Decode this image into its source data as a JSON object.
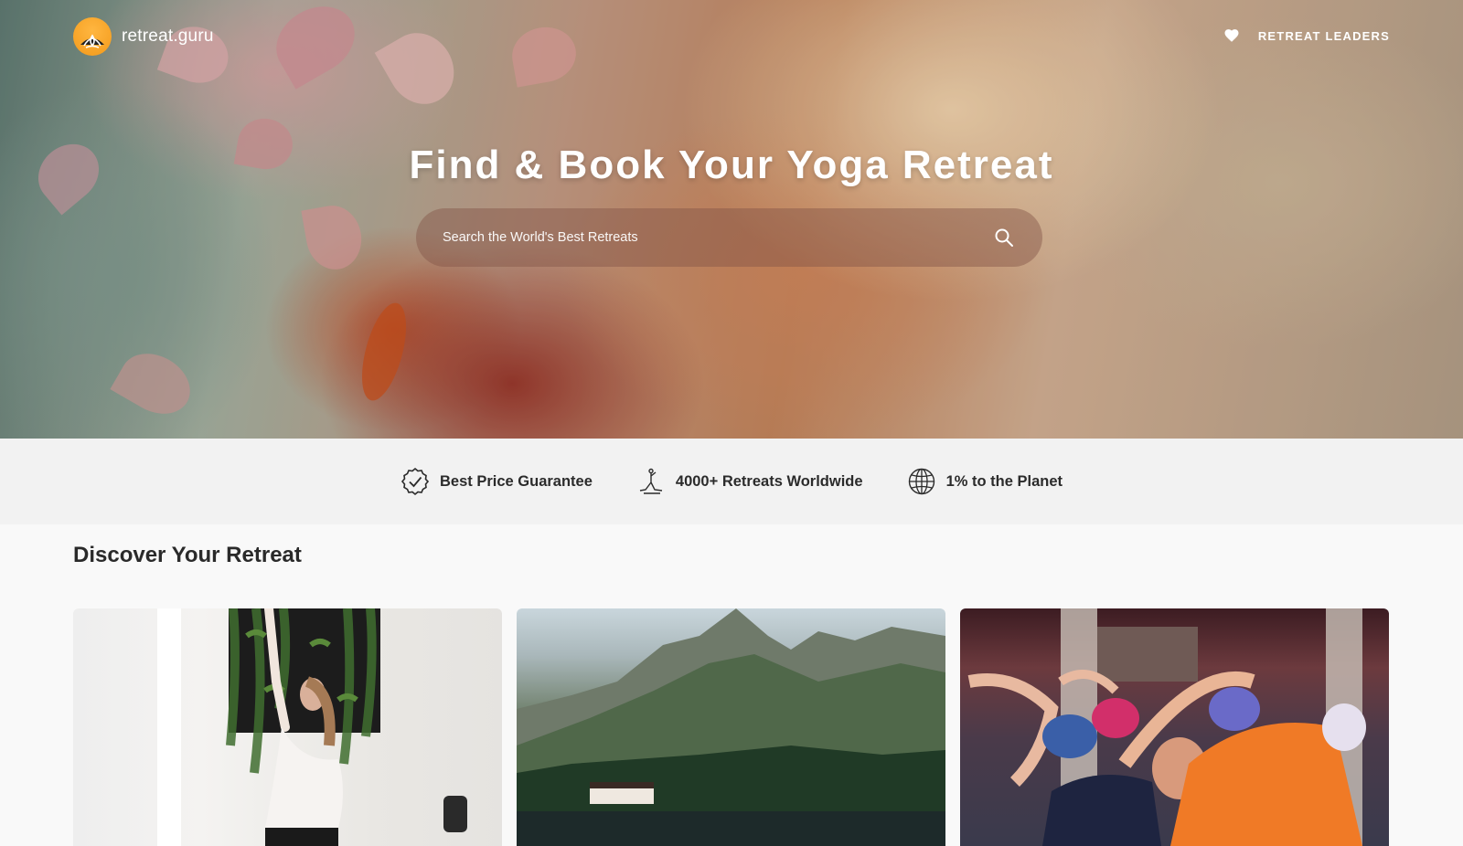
{
  "header": {
    "logo_text": "retreat.guru",
    "nav_link": "RETREAT LEADERS",
    "icons": {
      "logo": "lotus-sun-logo",
      "favorites": "heart-icon"
    }
  },
  "hero": {
    "title": "Find & Book Your Yoga Retreat",
    "search": {
      "placeholder": "Search the World's Best Retreats",
      "value": "",
      "icon": "search-icon"
    }
  },
  "features": [
    {
      "label": "Best Price Guarantee",
      "icon": "check-badge-icon"
    },
    {
      "label": "4000+ Retreats Worldwide",
      "icon": "yoga-pose-icon"
    },
    {
      "label": "1% to the Planet",
      "icon": "globe-icon"
    }
  ],
  "discover": {
    "title": "Discover Your Retreat",
    "cards": [
      {
        "image": "woman-yoga-pose-photo"
      },
      {
        "image": "mountain-lake-photo"
      },
      {
        "image": "yoga-class-stretching-photo"
      }
    ]
  },
  "colors": {
    "brand_orange": "#f39a1b",
    "text_dark": "#2a2a2a",
    "feature_bar_bg": "#f2f2f2"
  }
}
